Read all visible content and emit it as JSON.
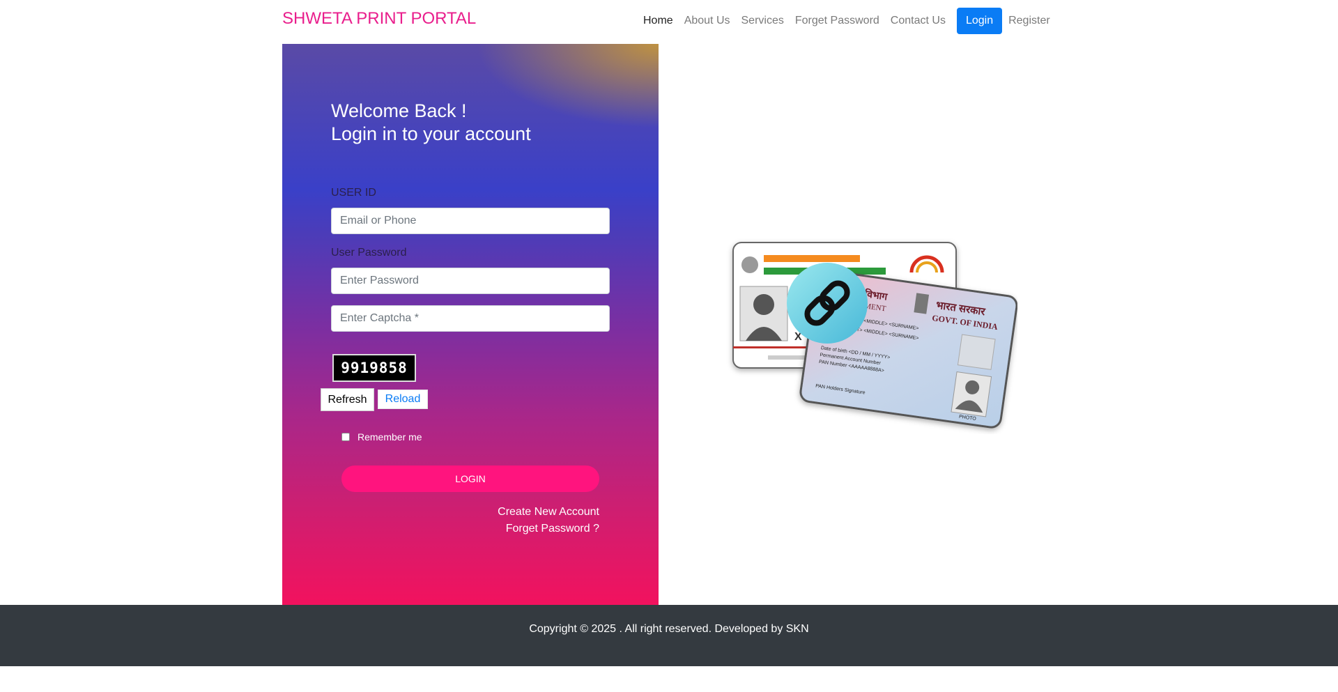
{
  "nav": {
    "brand": "SHWETA PRINT PORTAL",
    "items": [
      "Home",
      "About Us",
      "Services",
      "Forget Password",
      "Contact Us"
    ],
    "login": "Login",
    "register": "Register"
  },
  "login_form": {
    "welcome_line1": "Welcome Back !",
    "welcome_line2": "Login in to your account",
    "user_id_label": "USER ID",
    "user_id_placeholder": "Email or Phone",
    "password_label": "User Password",
    "password_placeholder": "Enter Password",
    "captcha_placeholder": "Enter Captcha *",
    "captcha_code": "9919858",
    "refresh_label": "Refresh",
    "reload_label": "Reload",
    "remember_label": "Remember me",
    "submit_label": "LOGIN",
    "create_account": "Create New Account",
    "forget_password": "Forget Password ?"
  },
  "illustration": {
    "aadhaar_mask": "X",
    "pan_lines": [
      "ल विभाग",
      "RTMENT",
      "भारत सरकार",
      "GOVT. OF INDIA",
      "<FIRST> <MIDDLE> <SURNAME>",
      "Fathers' <FIRST> <MIDDLE> <SURNAME>",
      "Date of birth <DD / MM / YYYY>",
      "Permanent Account Number",
      "PAN Number <AAAAA8888A>",
      "PAN Holders Signature",
      "PHOTO"
    ]
  },
  "footer": {
    "copyright": "Copyright © 2025 . All right reserved. Developed by SKN"
  },
  "colors": {
    "brand": "#e91e8c",
    "primary": "#0a7cf5",
    "login_button": "#ff147e",
    "footer_bg": "#343a40"
  }
}
